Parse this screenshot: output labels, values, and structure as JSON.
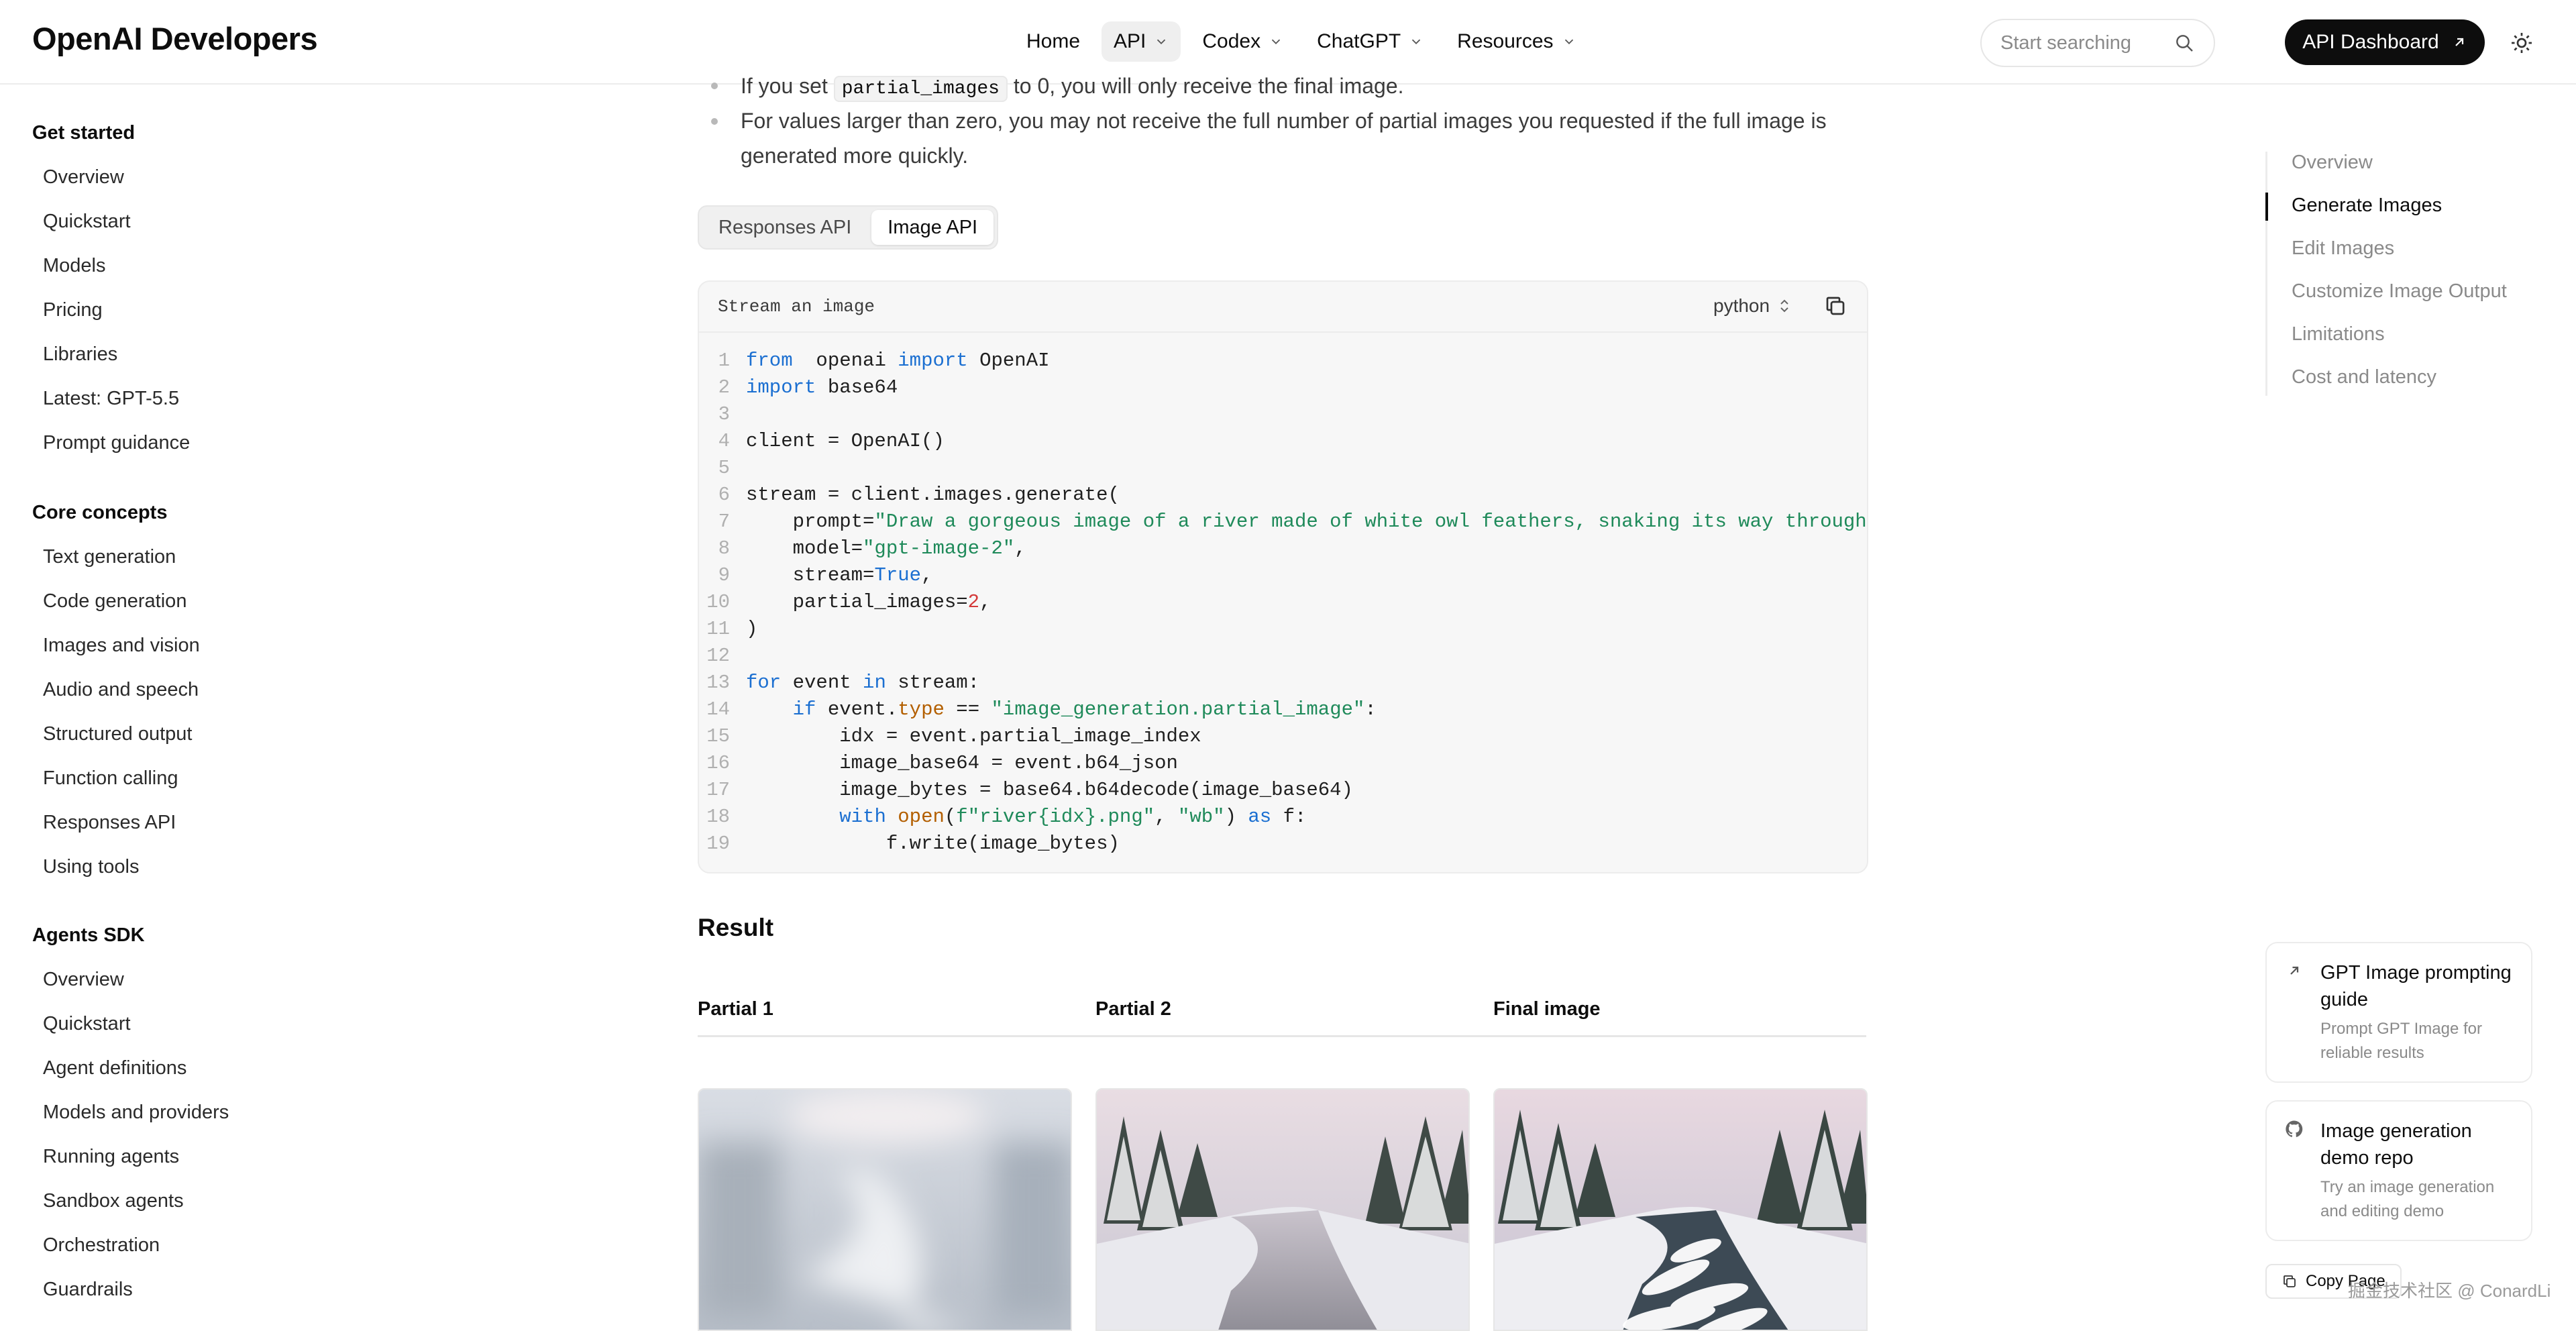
{
  "app": {
    "logo": "OpenAI Developers"
  },
  "topnav": [
    {
      "label": "Home"
    },
    {
      "label": "API"
    },
    {
      "label": "Codex"
    },
    {
      "label": "ChatGPT"
    },
    {
      "label": "Resources"
    }
  ],
  "search": {
    "placeholder": "Start searching"
  },
  "dashboard_button": {
    "label": "API Dashboard"
  },
  "sidebar": {
    "sections": [
      {
        "title": "Get started",
        "items": [
          "Overview",
          "Quickstart",
          "Models",
          "Pricing",
          "Libraries",
          "Latest: GPT-5.5",
          "Prompt guidance"
        ]
      },
      {
        "title": "Core concepts",
        "items": [
          "Text generation",
          "Code generation",
          "Images and vision",
          "Audio and speech",
          "Structured output",
          "Function calling",
          "Responses API",
          "Using tools"
        ]
      },
      {
        "title": "Agents SDK",
        "items": [
          "Overview",
          "Quickstart",
          "Agent definitions",
          "Models and providers",
          "Running agents",
          "Sandbox agents",
          "Orchestration",
          "Guardrails"
        ]
      }
    ]
  },
  "content": {
    "bullet1_pre": "If you set ",
    "bullet1_code": "partial_images",
    "bullet1_post": " to 0, you will only receive the final image.",
    "bullet2_line1": "For values larger than zero, you may not receive the full number of partial images you requested if the full image is",
    "bullet2_line2": "generated more quickly."
  },
  "tabs": [
    {
      "label": "Responses API",
      "active": false
    },
    {
      "label": "Image API",
      "active": true
    }
  ],
  "code": {
    "title": "Stream an image",
    "language": "python",
    "lines": [
      {
        "n": "1",
        "parts": [
          [
            "kw",
            "from"
          ],
          [
            "",
            "  openai "
          ],
          [
            "kw",
            "import"
          ],
          [
            "",
            " OpenAI"
          ]
        ]
      },
      {
        "n": "2",
        "parts": [
          [
            "kw",
            "import"
          ],
          [
            "",
            " base64"
          ]
        ]
      },
      {
        "n": "3",
        "parts": []
      },
      {
        "n": "4",
        "parts": [
          [
            "",
            "client = OpenAI()"
          ]
        ]
      },
      {
        "n": "5",
        "parts": []
      },
      {
        "n": "6",
        "parts": [
          [
            "",
            "stream = client.images.generate("
          ]
        ]
      },
      {
        "n": "7",
        "parts": [
          [
            "",
            "    prompt="
          ],
          [
            "st",
            "\"Draw a gorgeous image of a river made of white owl feathers, snaking its way through a se"
          ]
        ]
      },
      {
        "n": "8",
        "parts": [
          [
            "",
            "    model="
          ],
          [
            "st",
            "\"gpt-image-2\""
          ],
          [
            "",
            ","
          ]
        ]
      },
      {
        "n": "9",
        "parts": [
          [
            "",
            "    stream="
          ],
          [
            "kw",
            "True"
          ],
          [
            "",
            ","
          ]
        ]
      },
      {
        "n": "10",
        "parts": [
          [
            "",
            "    partial_images="
          ],
          [
            "nm",
            "2"
          ],
          [
            "",
            ","
          ]
        ]
      },
      {
        "n": "11",
        "parts": [
          [
            "",
            ")"
          ]
        ]
      },
      {
        "n": "12",
        "parts": []
      },
      {
        "n": "13",
        "parts": [
          [
            "kw",
            "for"
          ],
          [
            "",
            " event "
          ],
          [
            "kw",
            "in"
          ],
          [
            "",
            " stream:"
          ]
        ]
      },
      {
        "n": "14",
        "parts": [
          [
            "",
            "    "
          ],
          [
            "kw",
            "if"
          ],
          [
            "",
            " event."
          ],
          [
            "at",
            "type"
          ],
          [
            "",
            " == "
          ],
          [
            "st",
            "\"image_generation.partial_image\""
          ],
          [
            "",
            ":"
          ]
        ]
      },
      {
        "n": "15",
        "parts": [
          [
            "",
            "        idx = event.partial_image_index"
          ]
        ]
      },
      {
        "n": "16",
        "parts": [
          [
            "",
            "        image_base64 = event.b64_json"
          ]
        ]
      },
      {
        "n": "17",
        "parts": [
          [
            "",
            "        image_bytes = base64.b64decode(image_base64)"
          ]
        ]
      },
      {
        "n": "18",
        "parts": [
          [
            "",
            "        "
          ],
          [
            "kw",
            "with"
          ],
          [
            "",
            " "
          ],
          [
            "at",
            "open"
          ],
          [
            "",
            "("
          ],
          [
            "st",
            "f\"river{idx}.png\""
          ],
          [
            "",
            ", "
          ],
          [
            "st",
            "\"wb\""
          ],
          [
            "",
            ") "
          ],
          [
            "kw",
            "as"
          ],
          [
            "",
            " f:"
          ]
        ]
      },
      {
        "n": "19",
        "parts": [
          [
            "",
            "            f.write(image_bytes)"
          ]
        ]
      }
    ]
  },
  "result": {
    "title": "Result",
    "columns": [
      "Partial 1",
      "Partial 2",
      "Final image"
    ]
  },
  "toc": {
    "items": [
      "Overview",
      "Generate Images",
      "Edit Images",
      "Customize Image Output",
      "Limitations",
      "Cost and latency"
    ],
    "active_index": 1
  },
  "cards": [
    {
      "title": "GPT Image prompting guide",
      "desc": "Prompt GPT Image for reliable results",
      "icon": "arrow-up-right-icon"
    },
    {
      "title": "Image generation demo repo",
      "desc": "Try an image generation and editing demo",
      "icon": "github-icon"
    }
  ],
  "copy_page": {
    "label": "Copy Page"
  },
  "watermark": "掘金技术社区 @ ConardLi",
  "colors": {
    "accent": "#0d0d0d",
    "keyword": "#1b6fd1",
    "string": "#1f8a5a",
    "number": "#d43a3a"
  }
}
